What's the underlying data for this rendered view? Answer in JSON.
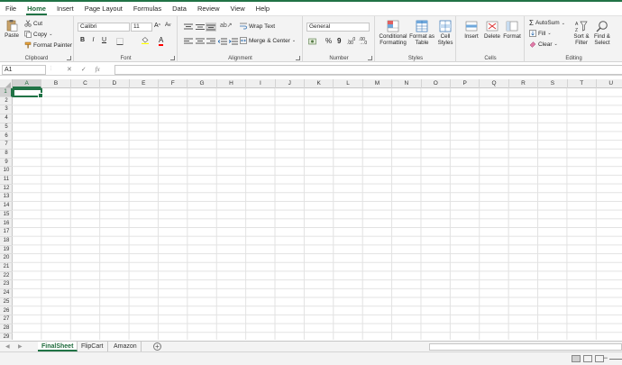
{
  "tabs": [
    "File",
    "Home",
    "Insert",
    "Page Layout",
    "Formulas",
    "Data",
    "Review",
    "View",
    "Help"
  ],
  "active_tab": "Home",
  "clipboard": {
    "paste": "Paste",
    "cut": "Cut",
    "copy": "Copy",
    "format_painter": "Format Painter",
    "label": "Clipboard"
  },
  "font": {
    "name": "Calibri",
    "size": "11",
    "bold": "B",
    "italic": "I",
    "underline": "U",
    "grow": "A",
    "shrink": "A",
    "label": "Font"
  },
  "alignment": {
    "wrap": "Wrap Text",
    "merge": "Merge & Center",
    "label": "Alignment"
  },
  "number": {
    "format": "General",
    "percent": "%",
    "comma": "9",
    "label": "Number"
  },
  "styles": {
    "conditional1": "Conditional",
    "conditional2": "Formatting",
    "format_as1": "Format as",
    "format_as2": "Table",
    "cell_styles1": "Cell",
    "cell_styles2": "Styles",
    "label": "Styles"
  },
  "cells_group": {
    "insert": "Insert",
    "delete": "Delete",
    "format": "Format",
    "label": "Cells"
  },
  "editing": {
    "autosum": "AutoSum",
    "fill": "Fill",
    "clear": "Clear",
    "sort1": "Sort &",
    "sort2": "Filter",
    "find1": "Find &",
    "find2": "Select",
    "label": "Editing"
  },
  "name_box": "A1",
  "fx": "fx",
  "columns": [
    "A",
    "B",
    "C",
    "D",
    "E",
    "F",
    "G",
    "H",
    "I",
    "J",
    "K",
    "L",
    "M",
    "N",
    "O",
    "P",
    "Q",
    "R",
    "S",
    "T",
    "U"
  ],
  "rows": [
    "1",
    "2",
    "3",
    "4",
    "5",
    "6",
    "7",
    "8",
    "9",
    "10",
    "11",
    "12",
    "13",
    "14",
    "15",
    "16",
    "17",
    "18",
    "19",
    "20",
    "21",
    "22",
    "23",
    "24",
    "25",
    "26",
    "27",
    "28",
    "29"
  ],
  "sheets": [
    "FinalSheet",
    "FlipCart",
    "Amazon"
  ],
  "active_sheet": "FinalSheet",
  "add_sheet": "+",
  "colors": {
    "accent": "#217346",
    "ribbon_bg": "#f3f3f3",
    "fill_yellow": "#ffff00",
    "font_red": "#ff0000"
  }
}
